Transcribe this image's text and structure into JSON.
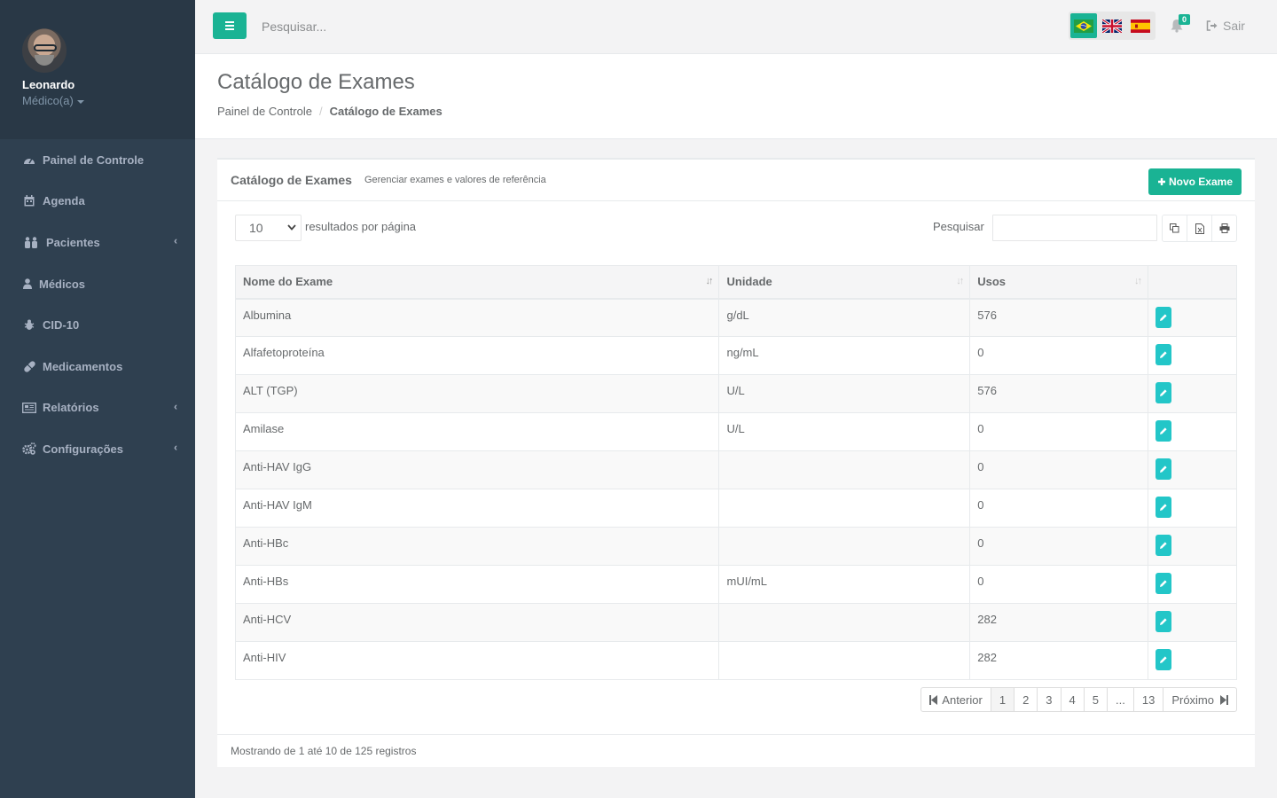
{
  "user": {
    "name": "Leonardo",
    "role": "Médico(a)"
  },
  "sidebar": {
    "items": [
      {
        "label": "Painel de Controle",
        "icon": "dashboard-icon"
      },
      {
        "label": "Agenda",
        "icon": "calendar-icon"
      },
      {
        "label": "Pacientes",
        "icon": "users-icon",
        "submenu": true
      },
      {
        "label": "Médicos",
        "icon": "user-md-icon"
      },
      {
        "label": "CID-10",
        "icon": "bug-icon"
      },
      {
        "label": "Medicamentos",
        "icon": "pill-icon"
      },
      {
        "label": "Relatórios",
        "icon": "newspaper-icon",
        "submenu": true
      },
      {
        "label": "Configurações",
        "icon": "cogs-icon",
        "submenu": true
      }
    ]
  },
  "topbar": {
    "search_placeholder": "Pesquisar...",
    "notifications_count": "0",
    "logout_label": "Sair",
    "languages": [
      "pt-BR",
      "en-GB",
      "es-ES"
    ],
    "active_language": "pt-BR"
  },
  "page": {
    "title": "Catálogo de Exames",
    "breadcrumb": [
      "Painel de Controle",
      "Catálogo de Exames"
    ]
  },
  "panel": {
    "title": "Catálogo de Exames",
    "subtitle": "Gerenciar exames e valores de referência",
    "new_button": "Novo Exame",
    "page_size": "10",
    "per_page_label": "resultados por página",
    "search_label": "Pesquisar",
    "search_value": ""
  },
  "table": {
    "columns": [
      "Nome do Exame",
      "Unidade",
      "Usos",
      ""
    ],
    "rows": [
      [
        "Albumina",
        "g/dL",
        "576"
      ],
      [
        "Alfafetoproteína",
        "ng/mL",
        "0"
      ],
      [
        "ALT (TGP)",
        "U/L",
        "576"
      ],
      [
        "Amilase",
        "U/L",
        "0"
      ],
      [
        "Anti-HAV IgG",
        "",
        "0"
      ],
      [
        "Anti-HAV IgM",
        "",
        "0"
      ],
      [
        "Anti-HBc",
        "",
        "0"
      ],
      [
        "Anti-HBs",
        "mUI/mL",
        "0"
      ],
      [
        "Anti-HCV",
        "",
        "282"
      ],
      [
        "Anti-HIV",
        "",
        "282"
      ]
    ]
  },
  "pagination": {
    "prev": "Anterior",
    "pages": [
      "1",
      "2",
      "3",
      "4",
      "5",
      "...",
      "13"
    ],
    "next": "Próximo",
    "current": "1"
  },
  "footer": {
    "summary": "Mostrando de 1 até 10 de 125 registros"
  },
  "colors": {
    "sidebar": "#2f4050",
    "accent": "#1ab394",
    "edit": "#23c6c8"
  }
}
